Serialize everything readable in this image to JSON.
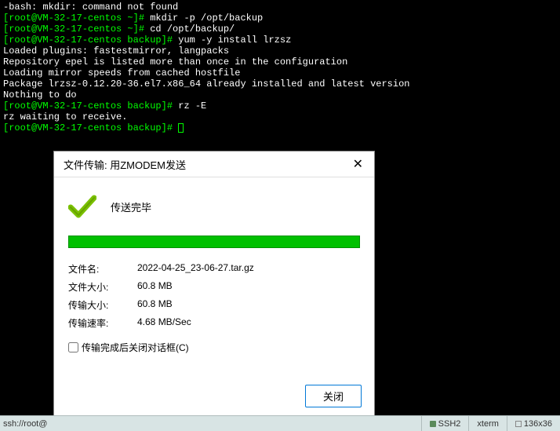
{
  "terminal": {
    "lines": [
      [
        {
          "cls": "w",
          "t": "-bash: mkdir: command not found"
        }
      ],
      [
        {
          "cls": "g",
          "t": "[root@VM-32-17-centos ~]# "
        },
        {
          "cls": "w",
          "t": "mkdir -p /opt/backup"
        }
      ],
      [
        {
          "cls": "g",
          "t": "[root@VM-32-17-centos ~]# "
        },
        {
          "cls": "w",
          "t": "cd /opt/backup/"
        }
      ],
      [
        {
          "cls": "g",
          "t": "[root@VM-32-17-centos backup]# "
        },
        {
          "cls": "w",
          "t": "yum -y install lrzsz"
        }
      ],
      [
        {
          "cls": "w",
          "t": "Loaded plugins: fastestmirror, langpacks"
        }
      ],
      [
        {
          "cls": "w",
          "t": "Repository epel is listed more than once in the configuration"
        }
      ],
      [
        {
          "cls": "w",
          "t": "Loading mirror speeds from cached hostfile"
        }
      ],
      [
        {
          "cls": "w",
          "t": "Package lrzsz-0.12.20-36.el7.x86_64 already installed and latest version"
        }
      ],
      [
        {
          "cls": "w",
          "t": "Nothing to do"
        }
      ],
      [
        {
          "cls": "g",
          "t": "[root@VM-32-17-centos backup]# "
        },
        {
          "cls": "w",
          "t": "rz -E"
        }
      ],
      [
        {
          "cls": "w",
          "t": "rz waiting to receive."
        }
      ],
      [
        {
          "cls": "g",
          "t": "[root@VM-32-17-centos backup]# "
        },
        {
          "cls": "cursor",
          "t": ""
        }
      ]
    ]
  },
  "dialog": {
    "title": "文件传输: 用ZMODEM发送",
    "status": "传送完毕",
    "info": {
      "filename_label": "文件名:",
      "filename_value": "2022-04-25_23-06-27.tar.gz",
      "filesize_label": "文件大小:",
      "filesize_value": "60.8 MB",
      "transfer_label": "传输大小:",
      "transfer_value": "60.8 MB",
      "speed_label": "传输速率:",
      "speed_value": "4.68 MB/Sec"
    },
    "checkbox_label": "传输完成后关闭对话框(C)",
    "close_button": "关闭"
  },
  "statusbar": {
    "left": "ssh://root@",
    "ssh": "SSH2",
    "term": "xterm",
    "size": "136x36"
  }
}
